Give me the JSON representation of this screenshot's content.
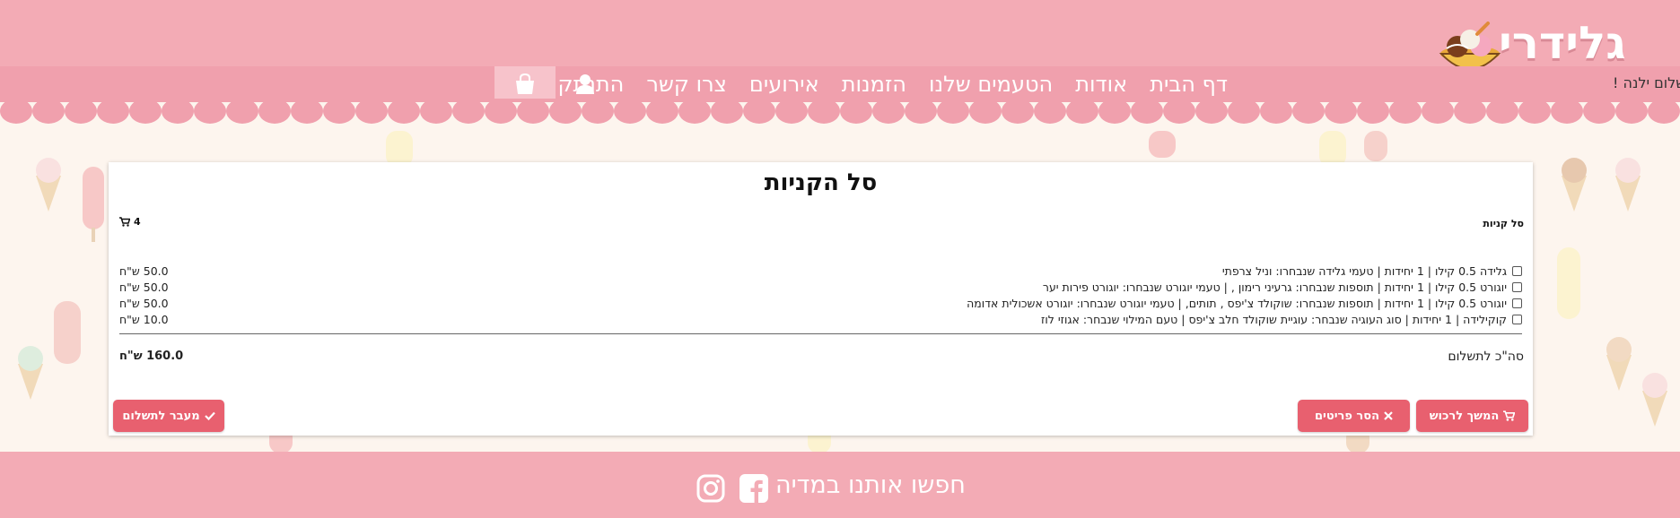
{
  "header": {
    "logo_text": "גלידרי",
    "greeting": "שלום ילנה !",
    "nav": {
      "home": "דף הבית",
      "about": "אודות",
      "flavors": "הטעמים שלנו",
      "orders": "הזמנות",
      "events": "אירועים",
      "contact": "צרו קשר",
      "logout": "התנתק"
    },
    "icons": {
      "user": "user-icon",
      "cart": "shopping-bag-icon"
    }
  },
  "cart": {
    "title": "סל הקניות",
    "label": "סל קניות",
    "count": "4",
    "items": [
      {
        "desc": "גלידה 0.5 קילו | 1 יחידות | טעמי גלידה שנבחרו: וניל צרפתי",
        "price": "50.0 ש\"ח"
      },
      {
        "desc": "יוגורט 0.5 קילו | 1 יחידות | תוספות שנבחרו: גרעיני רימון , | טעמי יוגורט שנבחרו: יוגורט פירות יער",
        "price": "50.0 ש\"ח"
      },
      {
        "desc": "יוגורט 0.5 קילו | 1 יחידות | תוספות שנבחרו: שוקולד צ'יפס , תותים, | טעמי יוגורט שנבחרו: יוגורט אשכולית אדומה",
        "price": "50.0 ש\"ח"
      },
      {
        "desc": "קוקילידה | 1 יחידות | סוג העוגיה שנבחר: עוגיית שוקולד חלב צ'יפס | טעם המילוי שנבחר: אגוזי לוז",
        "price": "10.0 ש\"ח"
      }
    ],
    "total_label": "סה\"כ לתשלום",
    "total_value": "160.0 ש\"ח",
    "buttons": {
      "continue": "המשך לרכוש",
      "remove": "הסר פריטים",
      "checkout": "מעבר לתשלום"
    }
  },
  "footer": {
    "text": "חפשו אותנו במדיה",
    "icons": {
      "facebook": "facebook-icon",
      "instagram": "instagram-icon"
    }
  },
  "colors": {
    "header_pink": "#f3abb5",
    "nav_pink": "#f0a0ad",
    "button_red": "#e8606f",
    "page_bg": "#fdf5ee"
  }
}
